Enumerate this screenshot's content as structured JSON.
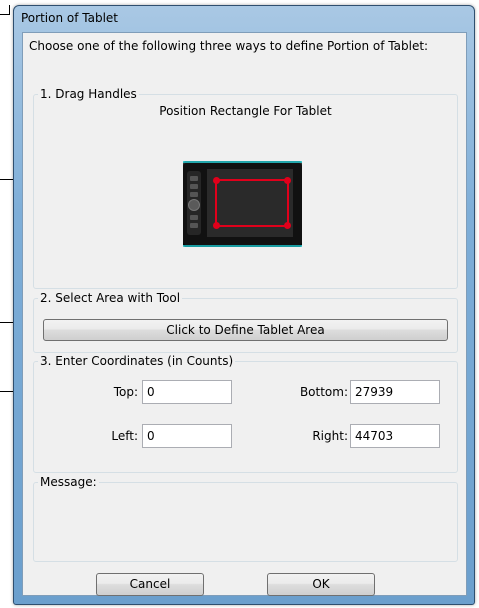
{
  "dialog": {
    "title": "Portion of Tablet",
    "intro": "Choose one of the following three ways to define Portion of Tablet:"
  },
  "drag_handles": {
    "label": "1. Drag Handles",
    "heading": "Position Rectangle For Tablet"
  },
  "select_area": {
    "label": "2. Select Area with Tool",
    "button_label": "Click to Define Tablet Area"
  },
  "coordinates": {
    "label": "3. Enter Coordinates (in Counts)",
    "top_label": "Top:",
    "top_value": "0",
    "bottom_label": "Bottom:",
    "bottom_value": "27939",
    "left_label": "Left:",
    "left_value": "0",
    "right_label": "Right:",
    "right_value": "44703"
  },
  "message": {
    "label": "Message:"
  },
  "footer": {
    "cancel_label": "Cancel",
    "ok_label": "OK"
  }
}
